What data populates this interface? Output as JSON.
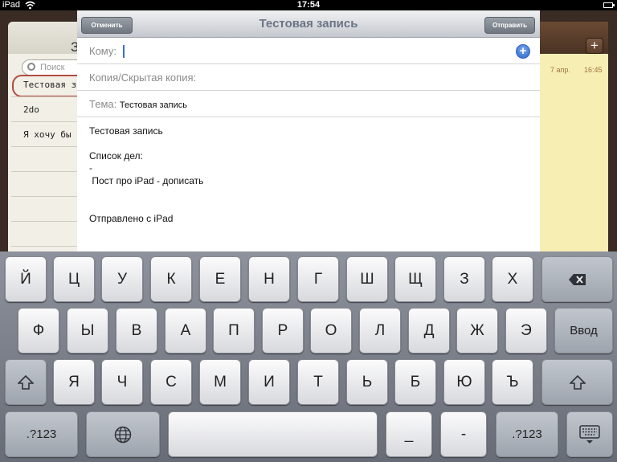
{
  "status_bar": {
    "carrier": "iPad",
    "time": "17:54"
  },
  "notes": {
    "list_title": "З",
    "search_placeholder": "Поиск",
    "items": [
      "Тестовая з",
      "2do",
      "Я хочу бы"
    ],
    "note_date": "7 апр.",
    "note_time": "16:45",
    "add_label": "+"
  },
  "compose": {
    "title": "Тестовая запись",
    "cancel_label": "Отменить",
    "send_label": "Отправить",
    "to_label": "Кому:",
    "cc_label": "Копия/Скрытая копия:",
    "subject_label": "Тема:",
    "subject_value": "Тестовая запись",
    "add_contact": "+",
    "body_lines": [
      "Тестовая запись",
      "Список дел:",
      "-",
      " Пост про iPad - дописать",
      "Отправлено с iPad"
    ]
  },
  "keyboard": {
    "row1": [
      "Й",
      "Ц",
      "У",
      "К",
      "Е",
      "Н",
      "Г",
      "Ш",
      "Щ",
      "З",
      "Х"
    ],
    "row2": [
      "Ф",
      "Ы",
      "В",
      "А",
      "П",
      "Р",
      "О",
      "Л",
      "Д",
      "Ж",
      "Э"
    ],
    "row3": [
      "Я",
      "Ч",
      "С",
      "М",
      "И",
      "Т",
      "Ь",
      "Б",
      "Ю",
      "Ъ"
    ],
    "return_label": "Ввод",
    "numbers_label": ".?123",
    "underscore_label": "_",
    "dash_label": "-"
  }
}
